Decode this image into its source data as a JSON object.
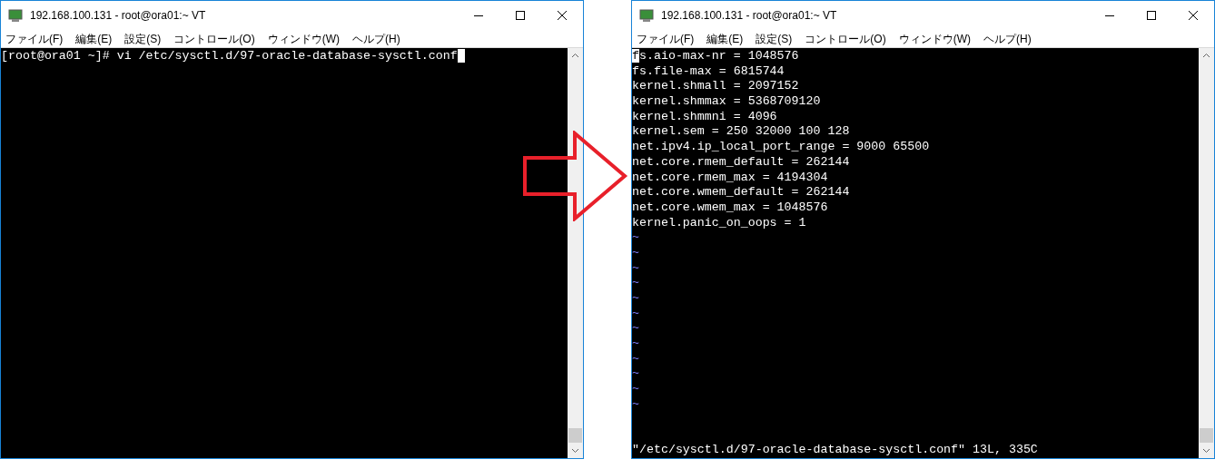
{
  "windows": [
    {
      "title": "192.168.100.131 - root@ora01:~ VT",
      "menu": [
        "ファイル(F)",
        "編集(E)",
        "設定(S)",
        "コントロール(O)",
        "ウィンドウ(W)",
        "ヘルプ(H)"
      ],
      "cursor_on_first_char": false,
      "lines": [
        {
          "kind": "text",
          "text": "[root@ora01 ~]# vi /etc/sysctl.d/97-oracle-database-sysctl.conf"
        }
      ]
    },
    {
      "title": "192.168.100.131 - root@ora01:~ VT",
      "menu": [
        "ファイル(F)",
        "編集(E)",
        "設定(S)",
        "コントロール(O)",
        "ウィンドウ(W)",
        "ヘルプ(H)"
      ],
      "cursor_on_first_char": true,
      "lines": [
        {
          "kind": "text",
          "text": "fs.aio-max-nr = 1048576"
        },
        {
          "kind": "text",
          "text": "fs.file-max = 6815744"
        },
        {
          "kind": "text",
          "text": "kernel.shmall = 2097152"
        },
        {
          "kind": "text",
          "text": "kernel.shmmax = 5368709120"
        },
        {
          "kind": "text",
          "text": "kernel.shmmni = 4096"
        },
        {
          "kind": "text",
          "text": "kernel.sem = 250 32000 100 128"
        },
        {
          "kind": "text",
          "text": "net.ipv4.ip_local_port_range = 9000 65500"
        },
        {
          "kind": "text",
          "text": "net.core.rmem_default = 262144"
        },
        {
          "kind": "text",
          "text": "net.core.rmem_max = 4194304"
        },
        {
          "kind": "text",
          "text": "net.core.wmem_default = 262144"
        },
        {
          "kind": "text",
          "text": "net.core.wmem_max = 1048576"
        },
        {
          "kind": "text",
          "text": "kernel.panic_on_oops = 1"
        },
        {
          "kind": "tilde",
          "text": "~"
        },
        {
          "kind": "tilde",
          "text": "~"
        },
        {
          "kind": "tilde",
          "text": "~"
        },
        {
          "kind": "tilde",
          "text": "~"
        },
        {
          "kind": "tilde",
          "text": "~"
        },
        {
          "kind": "tilde",
          "text": "~"
        },
        {
          "kind": "tilde",
          "text": "~"
        },
        {
          "kind": "tilde",
          "text": "~"
        },
        {
          "kind": "tilde",
          "text": "~"
        },
        {
          "kind": "tilde",
          "text": "~"
        },
        {
          "kind": "tilde",
          "text": "~"
        },
        {
          "kind": "tilde",
          "text": "~"
        },
        {
          "kind": "status",
          "text": "\"/etc/sysctl.d/97-oracle-database-sysctl.conf\" 13L, 335C"
        }
      ]
    }
  ]
}
